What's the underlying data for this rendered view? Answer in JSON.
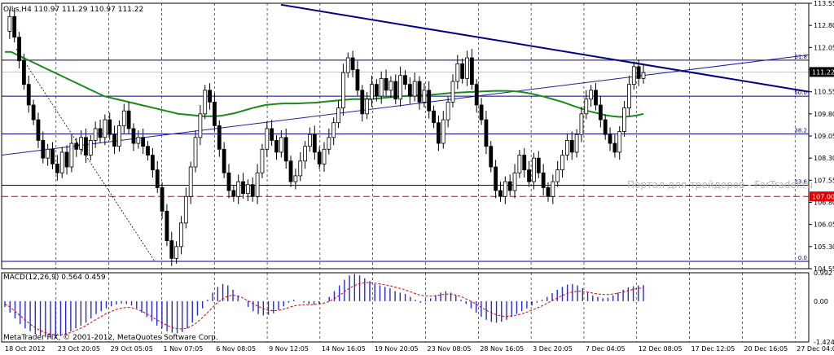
{
  "chart_data": {
    "type": "candlestick",
    "symbol_header": "OILs,H4  110.97 111.29 110.97 111.22",
    "watermark": "Портал для трейдеров - ForTrader.ru",
    "copyright": "MetaTrader FIX, © 2001-2012, MetaQuotes Software Corp.",
    "current_price": "111.22",
    "alert_price": "107.00",
    "price_ticks": [
      "113.55",
      "112.80",
      "112.05",
      "111.30",
      "110.55",
      "109.80",
      "109.05",
      "108.30",
      "107.55",
      "106.80",
      "106.05",
      "105.30",
      "104.55"
    ],
    "price_range": [
      104.55,
      113.55
    ],
    "time_labels": [
      "18 Oct 2012",
      "23 Oct 20:05",
      "29 Oct 05:05",
      "1 Nov 07:05",
      "6 Nov 08:05",
      "9 Nov 12:05",
      "14 Nov 16:05",
      "19 Nov 20:05",
      "23 Nov 08:05",
      "28 Nov 16:05",
      "3 Dec 20:05",
      "7 Dec 04:05",
      "12 Dec 08:05",
      "17 Dec 12:05",
      "20 Dec 16:05",
      "27 Dec 04:05"
    ],
    "fib_levels": [
      {
        "label": "61.8",
        "price": 111.62
      },
      {
        "label": "50.0",
        "price": 110.4
      },
      {
        "label": "38.2",
        "price": 109.12
      },
      {
        "label": "23.6",
        "price": 107.38
      },
      {
        "label": "0.0",
        "price": 104.8
      }
    ],
    "price_series": [
      112.6,
      113.1,
      112.4,
      111.6,
      110.8,
      110.1,
      109.6,
      108.9,
      108.3,
      108.6,
      108.1,
      107.8,
      108.5,
      108.0,
      108.8,
      108.6,
      109.0,
      108.4,
      108.9,
      109.3,
      109.0,
      109.6,
      109.1,
      108.7,
      109.4,
      109.9,
      109.3,
      108.8,
      109.0,
      108.7,
      108.4,
      107.9,
      107.3,
      106.5,
      105.5,
      104.9,
      105.3,
      106.1,
      107.0,
      108.0,
      109.0,
      109.8,
      110.6,
      110.2,
      109.4,
      108.6,
      107.8,
      107.2,
      107.0,
      107.5,
      107.1,
      107.4,
      107.0,
      107.8,
      108.6,
      109.3,
      108.9,
      108.5,
      109.0,
      108.2,
      107.5,
      107.7,
      108.2,
      108.7,
      109.1,
      108.5,
      108.1,
      108.6,
      109.0,
      109.5,
      110.0,
      111.2,
      111.7,
      111.3,
      110.6,
      109.8,
      110.3,
      110.8,
      110.4,
      111.0,
      110.6,
      110.9,
      110.3,
      111.1,
      110.8,
      110.4,
      110.9,
      110.2,
      110.6,
      109.9,
      109.5,
      108.8,
      109.6,
      110.2,
      110.9,
      111.5,
      111.0,
      111.7,
      110.8,
      110.1,
      109.6,
      108.7,
      108.0,
      107.2,
      107.0,
      107.5,
      107.2,
      107.8,
      108.4,
      107.9,
      107.5,
      108.3,
      107.8,
      107.3,
      107.0,
      107.5,
      107.9,
      108.4,
      108.9,
      108.5,
      109.1,
      109.8,
      110.3,
      110.6,
      110.1,
      109.6,
      109.1,
      108.8,
      108.5,
      109.2,
      110.0,
      110.8,
      111.4,
      111.0,
      111.2
    ],
    "ma_series": [
      111.9,
      111.9,
      111.8,
      111.7,
      111.6,
      111.5,
      111.4,
      111.3,
      111.2,
      111.1,
      111.0,
      110.9,
      110.8,
      110.7,
      110.6,
      110.5,
      110.4,
      110.35,
      110.3,
      110.25,
      110.2,
      110.15,
      110.1,
      110.05,
      110.0,
      109.95,
      109.9,
      109.85,
      109.8,
      109.78,
      109.76,
      109.74,
      109.72,
      109.72,
      109.72,
      109.74,
      109.78,
      109.82,
      109.88,
      109.94,
      110.0,
      110.05,
      110.1,
      110.12,
      110.14,
      110.15,
      110.15,
      110.15,
      110.16,
      110.17,
      110.18,
      110.2,
      110.22,
      110.24,
      110.26,
      110.28,
      110.3,
      110.3,
      110.3,
      110.3,
      110.32,
      110.34,
      110.36,
      110.38,
      110.4,
      110.41,
      110.42,
      110.43,
      110.44,
      110.45,
      110.47,
      110.49,
      110.51,
      110.52,
      110.53,
      110.54,
      110.55,
      110.56,
      110.57,
      110.58,
      110.58,
      110.58,
      110.57,
      110.55,
      110.52,
      110.48,
      110.43,
      110.38,
      110.32,
      110.26,
      110.2,
      110.12,
      110.05,
      109.98,
      109.9,
      109.85,
      109.8,
      109.75,
      109.72,
      109.7,
      109.7,
      109.72,
      109.75,
      109.8
    ],
    "trendline_down": {
      "from_price": 113.5,
      "to_price": 110.55
    },
    "trendline_up": {
      "from_price": 108.4,
      "to_price": 111.8
    },
    "macd_label": "MACD(12,26,9)  0.564  0.459",
    "macd_ticks": [
      "0.992",
      "0.00",
      "-1.424"
    ],
    "macd_range": [
      -1.424,
      0.992
    ],
    "macd_hist": [
      -0.2,
      -0.4,
      -0.6,
      -0.8,
      -0.95,
      -1.05,
      -1.15,
      -1.2,
      -1.25,
      -1.3,
      -1.28,
      -1.22,
      -1.15,
      -1.05,
      -0.95,
      -0.85,
      -0.75,
      -0.6,
      -0.45,
      -0.35,
      -0.25,
      -0.18,
      -0.12,
      -0.08,
      -0.1,
      -0.15,
      -0.25,
      -0.4,
      -0.55,
      -0.7,
      -0.85,
      -0.95,
      -1.05,
      -1.1,
      -1.12,
      -1.08,
      -0.95,
      -0.75,
      -0.5,
      -0.25,
      0.05,
      0.3,
      0.5,
      0.6,
      0.55,
      0.4,
      0.2,
      0.0,
      -0.2,
      -0.35,
      -0.45,
      -0.5,
      -0.48,
      -0.42,
      -0.3,
      -0.18,
      -0.05,
      0.05,
      0.0,
      -0.05,
      -0.1,
      -0.12,
      -0.08,
      0.0,
      0.15,
      0.35,
      0.55,
      0.75,
      0.9,
      0.95,
      0.9,
      0.8,
      0.7,
      0.6,
      0.55,
      0.5,
      0.45,
      0.35,
      0.3,
      0.25,
      0.15,
      0.05,
      -0.05,
      0.05,
      0.1,
      0.2,
      0.3,
      0.35,
      0.3,
      0.2,
      0.05,
      -0.1,
      -0.25,
      -0.4,
      -0.55,
      -0.65,
      -0.72,
      -0.75,
      -0.72,
      -0.65,
      -0.55,
      -0.45,
      -0.35,
      -0.25,
      -0.15,
      -0.05,
      0.05,
      0.15,
      0.28,
      0.4,
      0.5,
      0.58,
      0.6,
      0.55,
      0.45,
      0.3,
      0.2,
      0.15,
      0.1,
      0.12,
      0.2,
      0.3,
      0.4,
      0.48,
      0.52,
      0.55,
      0.56
    ],
    "macd_signal": [
      -0.1,
      -0.2,
      -0.35,
      -0.5,
      -0.65,
      -0.8,
      -0.92,
      -1.02,
      -1.1,
      -1.15,
      -1.18,
      -1.18,
      -1.15,
      -1.1,
      -1.03,
      -0.95,
      -0.86,
      -0.76,
      -0.65,
      -0.55,
      -0.45,
      -0.37,
      -0.3,
      -0.25,
      -0.22,
      -0.22,
      -0.26,
      -0.33,
      -0.42,
      -0.52,
      -0.63,
      -0.73,
      -0.82,
      -0.9,
      -0.95,
      -0.97,
      -0.95,
      -0.88,
      -0.77,
      -0.62,
      -0.45,
      -0.27,
      -0.1,
      0.05,
      0.15,
      0.2,
      0.2,
      0.14,
      0.05,
      -0.05,
      -0.15,
      -0.23,
      -0.3,
      -0.33,
      -0.33,
      -0.3,
      -0.25,
      -0.19,
      -0.15,
      -0.13,
      -0.12,
      -0.12,
      -0.11,
      -0.09,
      -0.04,
      0.04,
      0.14,
      0.26,
      0.39,
      0.5,
      0.58,
      0.63,
      0.65,
      0.64,
      0.62,
      0.59,
      0.56,
      0.52,
      0.47,
      0.43,
      0.37,
      0.31,
      0.24,
      0.2,
      0.18,
      0.18,
      0.2,
      0.23,
      0.25,
      0.24,
      0.2,
      0.14,
      0.06,
      -0.03,
      -0.13,
      -0.24,
      -0.34,
      -0.42,
      -0.49,
      -0.52,
      -0.53,
      -0.51,
      -0.48,
      -0.43,
      -0.37,
      -0.3,
      -0.23,
      -0.15,
      -0.06,
      0.03,
      0.12,
      0.21,
      0.28,
      0.33,
      0.35,
      0.34,
      0.31,
      0.28,
      0.25,
      0.23,
      0.23,
      0.25,
      0.28,
      0.32,
      0.37,
      0.41,
      0.45,
      0.459
    ]
  }
}
